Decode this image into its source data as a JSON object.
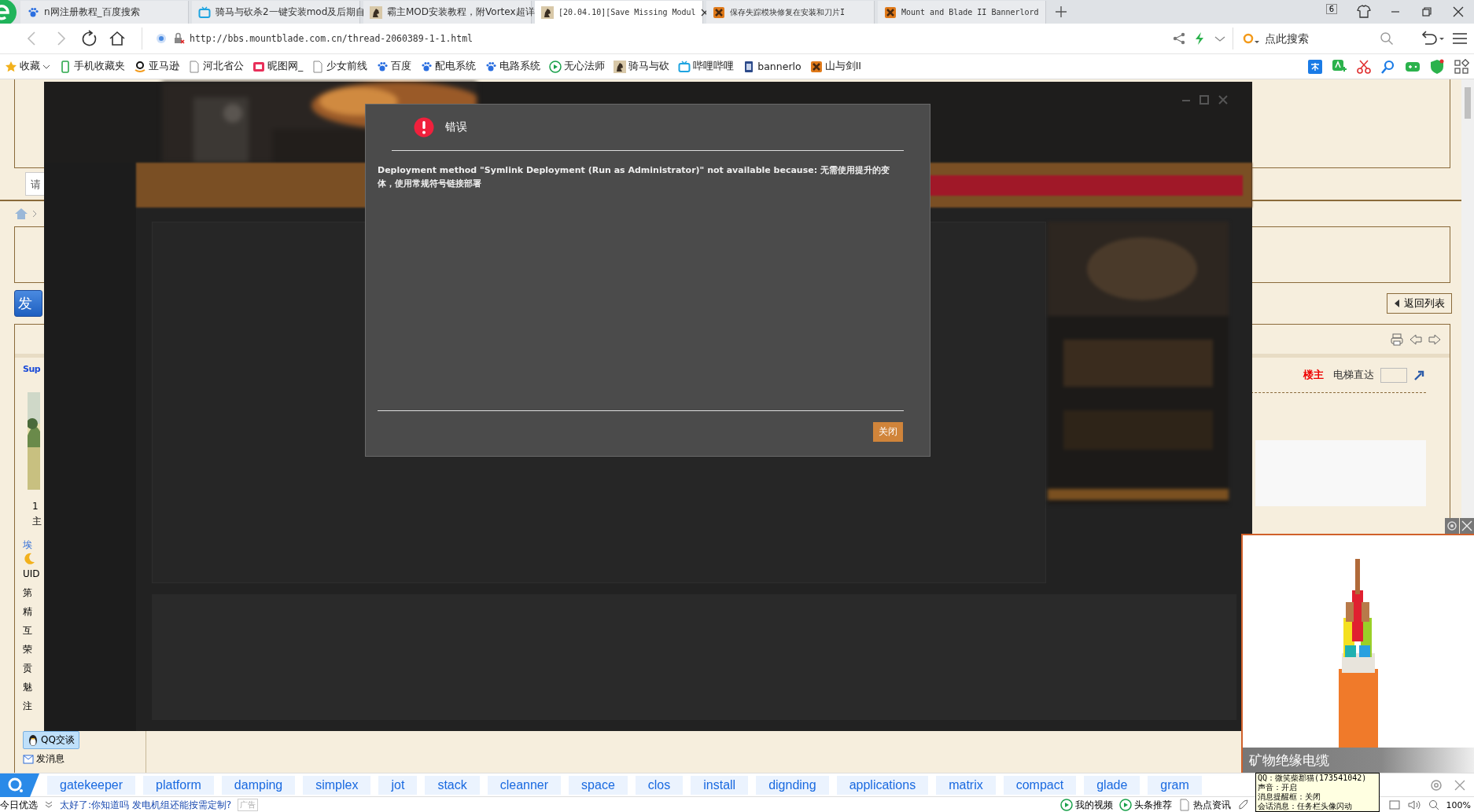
{
  "browser": {
    "tabs": [
      {
        "title": "n网注册教程_百度搜索",
        "kind": "paw",
        "selected": false
      },
      {
        "title": "骑马与砍杀2一键安装mod及后期自",
        "kind": "tv",
        "selected": false
      },
      {
        "title": "霸主MOD安装教程，附Vortex超详",
        "kind": "knight",
        "selected": false
      },
      {
        "title": "[20.04.10][Save Missing Modul",
        "kind": "knight",
        "selected": true
      },
      {
        "title": "保存失踪模块修复在安装和刀片I",
        "kind": "crest",
        "selected": false
      },
      {
        "title": "Mount and Blade II Bannerlord",
        "kind": "crest",
        "selected": false
      }
    ],
    "tab_count": "6",
    "address": "http://bbs.mountblade.com.cn/thread-2060389-1-1.html",
    "search_placeholder": "点此搜索"
  },
  "bookmarks": [
    {
      "label": "收藏",
      "kind": "star"
    },
    {
      "label": "手机收藏夹",
      "kind": "phone"
    },
    {
      "label": "亚马逊",
      "kind": "smile"
    },
    {
      "label": "河北省公",
      "kind": "page"
    },
    {
      "label": "昵图网_",
      "kind": "logo"
    },
    {
      "label": "少女前线",
      "kind": "page"
    },
    {
      "label": "百度",
      "kind": "paw"
    },
    {
      "label": "配电系统",
      "kind": "paw"
    },
    {
      "label": "电路系统",
      "kind": "paw"
    },
    {
      "label": "无心法师",
      "kind": "play"
    },
    {
      "label": "骑马与砍",
      "kind": "knight"
    },
    {
      "label": "哔哩哔哩",
      "kind": "tv"
    },
    {
      "label": "bannerlo",
      "kind": "doc"
    },
    {
      "label": "山与剑II",
      "kind": "crest"
    }
  ],
  "forum": {
    "search_placeholder": "请",
    "post_button": "发",
    "back_button": "返回列表",
    "author": "Sup",
    "floor": "楼主",
    "jump_label": "电梯直达",
    "profile_fragments": [
      "1",
      "主"
    ],
    "profile_link": "埃",
    "stat_fragments": [
      "UID",
      "第",
      "精",
      "互",
      "荣",
      "贡",
      "魅",
      "注"
    ],
    "qq_button": "QQ交谈",
    "message_link": "发消息"
  },
  "dialog": {
    "title": "错误",
    "message": "Deployment method \"Symlink Deployment (Run as Administrator)\" not available because: 无需使用提升的变体，使用常规符号链接部署",
    "button": "关闭"
  },
  "ad": {
    "caption": "矿物绝缘电缆"
  },
  "keyword_bar": {
    "words": [
      "gatekeeper",
      "platform",
      "damping",
      "simplex",
      "jot",
      "stack",
      "cleanner",
      "space",
      "clos",
      "install",
      "dignding",
      "applications",
      "matrix",
      "compact",
      "glade",
      "gram"
    ]
  },
  "tooltip": {
    "lines": [
      "QQ：微笑柴郡猫(173541042)",
      "声音：开启",
      "消息提醒框：关闭",
      "会话消息：任务栏头像闪动"
    ]
  },
  "status_bar": {
    "left": "今日优选",
    "headline": "太好了:你知道吗 发电机组还能按需定制?",
    "ad_label": "广告",
    "items": [
      {
        "label": "我的视频",
        "kind": "play"
      },
      {
        "label": "头条推荐",
        "kind": "play"
      },
      {
        "label": "热点资讯",
        "kind": "page"
      }
    ],
    "zoom": "100%"
  }
}
